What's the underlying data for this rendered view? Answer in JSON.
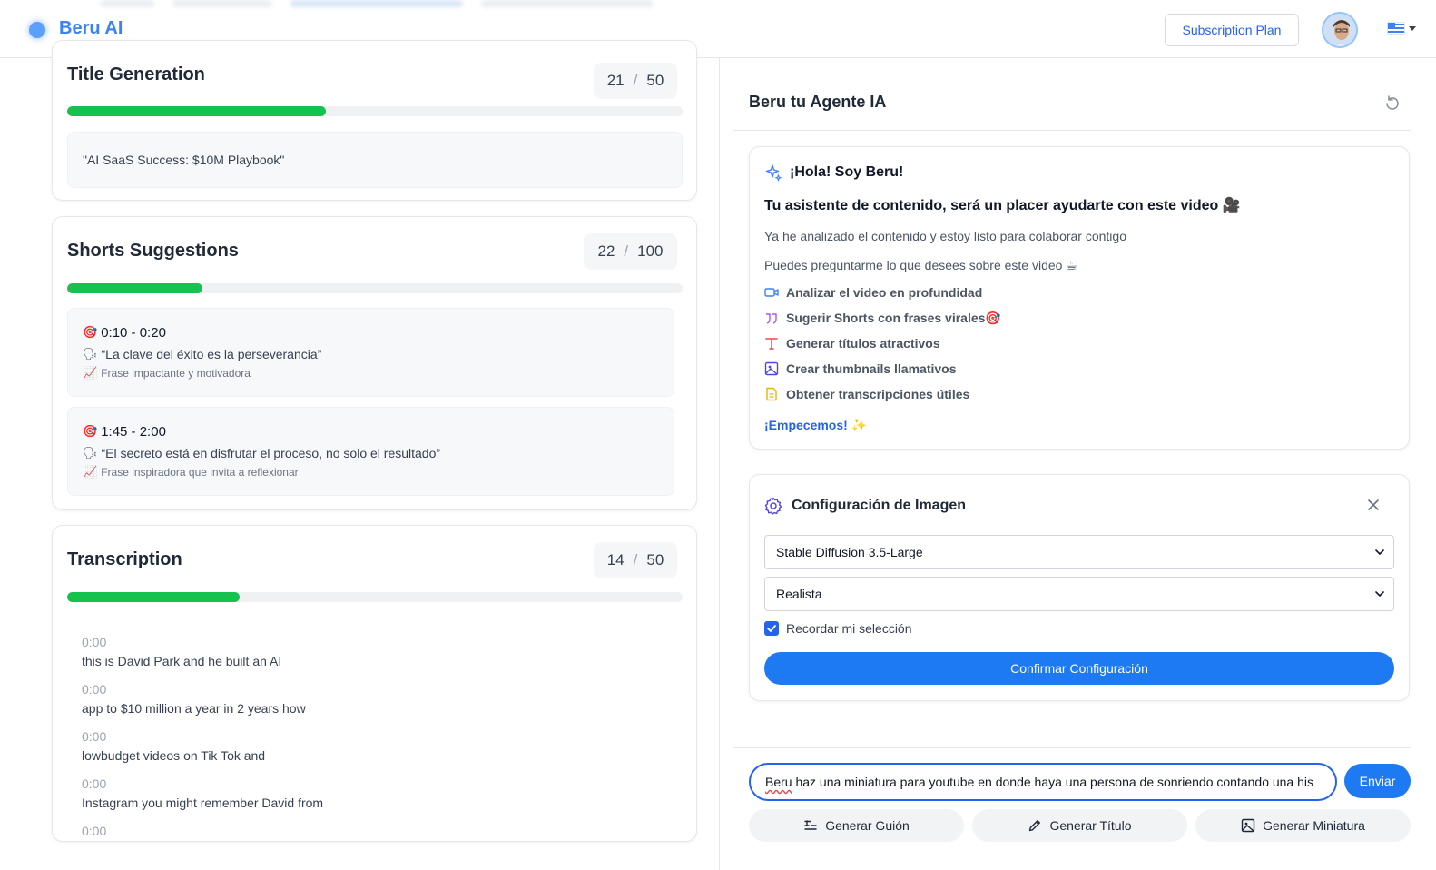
{
  "header": {
    "app_name": "Beru AI",
    "subscription_label": "Subscription Plan",
    "accent": "#3b82f6"
  },
  "left": {
    "title_card": {
      "title": "Title Generation",
      "count": "21",
      "limit": "50",
      "progress": 0.42,
      "suggestion": "\"AI SaaS Success: $10M Playbook\""
    },
    "shorts_card": {
      "title": "Shorts Suggestions",
      "count": "22",
      "limit": "100",
      "progress": 0.22,
      "items": [
        {
          "time": "0:10 - 0:20",
          "phrase": "“La clave del éxito es la perseverancia”",
          "note": "Frase impactante y motivadora"
        },
        {
          "time": "1:45 - 2:00",
          "phrase": "“El secreto está en disfrutar el proceso, no solo el resultado”",
          "note": "Frase inspiradora que invita a reflexionar"
        }
      ]
    },
    "transcription_card": {
      "title": "Transcription",
      "count": "14",
      "limit": "50",
      "progress": 0.28,
      "lines": [
        {
          "time": "0:00",
          "text": "this is David Park and he built an AI"
        },
        {
          "time": "0:00",
          "text": "app to $10 million a year in 2 years how"
        },
        {
          "time": "0:00",
          "text": "lowbudget videos on Tik Tok and"
        },
        {
          "time": "0:00",
          "text": "Instagram you might remember David from"
        },
        {
          "time": "0:00",
          "text": ""
        }
      ]
    }
  },
  "agent": {
    "title": "Beru tu Agente IA",
    "greeting": "¡Hola! Soy Beru!",
    "subtitle": "Tu asistente de contenido, será un placer ayudarte con este video 🎥",
    "paragraph1": "Ya he analizado el contenido y estoy listo para colaborar contigo",
    "paragraph2": "Puedes preguntarme lo que desees sobre este video ☕",
    "features": [
      {
        "icon": "video-icon",
        "label": "Analizar el video en profundidad"
      },
      {
        "icon": "quote-icon",
        "label": "Sugerir Shorts con frases virales🎯"
      },
      {
        "icon": "type-icon",
        "label": "Generar títulos atractivos"
      },
      {
        "icon": "image-icon",
        "label": "Crear thumbnails llamativos"
      },
      {
        "icon": "document-icon",
        "label": "Obtener transcripciones útiles"
      }
    ],
    "cta": "¡Empecemos! ✨"
  },
  "config": {
    "title": "Configuración de Imagen",
    "model": "Stable Diffusion 3.5-Large",
    "style": "Realista",
    "remember_label": "Recordar mi selección",
    "remember_checked": true,
    "confirm_label": "Confirmar Configuración"
  },
  "chat": {
    "input_first_word": "Beru",
    "input_rest": " haz una miniatura para youtube en donde haya una persona de sonriendo contando una his",
    "send_label": "Enviar",
    "actions": [
      {
        "icon": "script-icon",
        "label": "Generar Guión"
      },
      {
        "icon": "pencil-icon",
        "label": "Generar Título"
      },
      {
        "icon": "image-icon",
        "label": "Generar Miniatura"
      }
    ]
  }
}
